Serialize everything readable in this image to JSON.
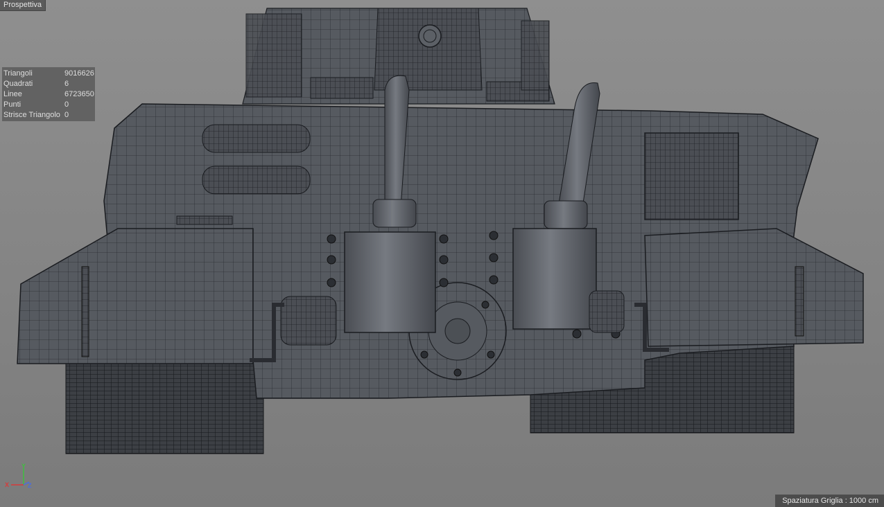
{
  "viewport": {
    "view_name": "Prospettiva",
    "background": "#888888"
  },
  "stats": {
    "rows": [
      {
        "label": "Triangoli",
        "value": "9016626"
      },
      {
        "label": "Quadrati",
        "value": "6"
      },
      {
        "label": "Linee",
        "value": "6723650"
      },
      {
        "label": "Punti",
        "value": "0"
      },
      {
        "label": "Strisce Triangolo",
        "value": "0"
      }
    ]
  },
  "axis_gizmo": {
    "x": "X",
    "y": "Y",
    "z": "Z"
  },
  "status": {
    "grid_spacing": "Spaziatura Griglia : 1000 cm"
  },
  "model": {
    "object": "tank-wireframe",
    "shading": "gouraud-lines",
    "fill": "#55585e",
    "wire": "#1a1c20"
  }
}
